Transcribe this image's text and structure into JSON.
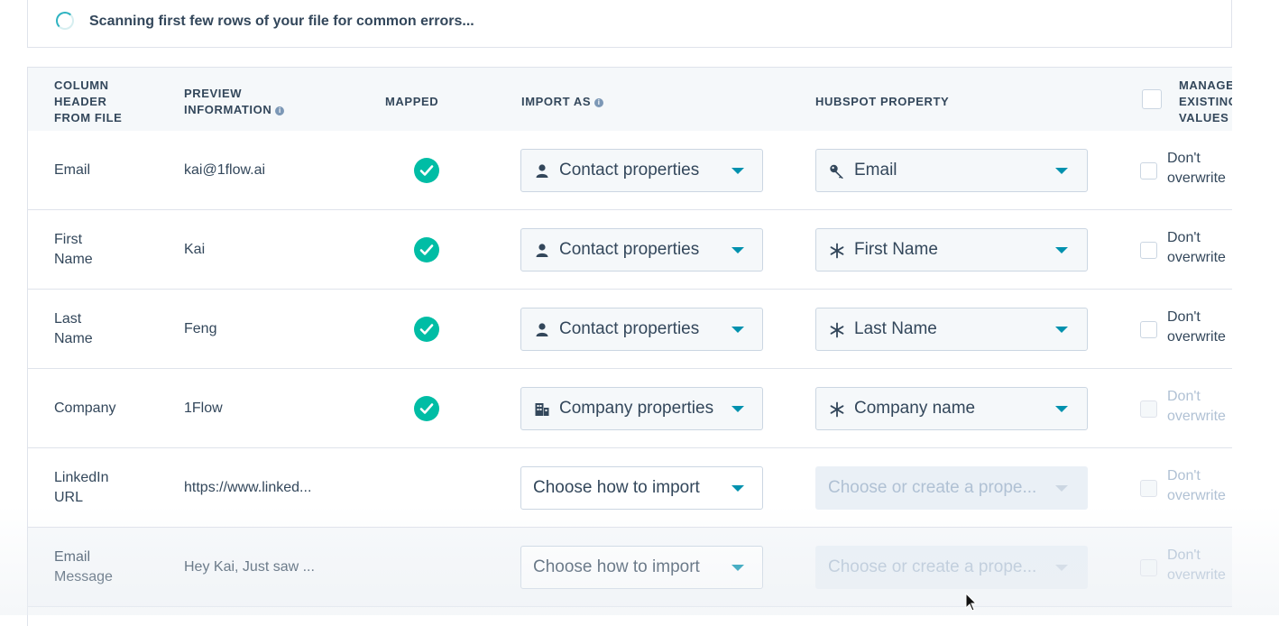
{
  "scan": {
    "message": "Scanning first few rows of your file for common errors..."
  },
  "table": {
    "headers": {
      "column_header": [
        "COLUMN",
        "HEADER",
        "FROM FILE"
      ],
      "preview": [
        "PREVIEW",
        "INFORMATION"
      ],
      "mapped": "MAPPED",
      "import_as": "IMPORT AS",
      "hubspot_property": "HUBSPOT PROPERTY",
      "manage": [
        "MANAGE",
        "EXISTING",
        "VALUES"
      ]
    },
    "rows": [
      {
        "column": [
          "Email"
        ],
        "preview": "kai@1flow.ai",
        "mapped": true,
        "import_as": {
          "label": "Contact properties",
          "icon": "person-icon"
        },
        "property": {
          "label": "Email",
          "icon": "key-icon",
          "disabled": false
        },
        "manage": [
          "Don't",
          "overwrite"
        ],
        "manage_enabled": true
      },
      {
        "column": [
          "First",
          "Name"
        ],
        "preview": "Kai",
        "mapped": true,
        "import_as": {
          "label": "Contact properties",
          "icon": "person-icon"
        },
        "property": {
          "label": "First Name",
          "icon": "asterisk-icon",
          "disabled": false
        },
        "manage": [
          "Don't",
          "overwrite"
        ],
        "manage_enabled": true
      },
      {
        "column": [
          "Last",
          "Name"
        ],
        "preview": "Feng",
        "mapped": true,
        "import_as": {
          "label": "Contact properties",
          "icon": "person-icon"
        },
        "property": {
          "label": "Last Name",
          "icon": "asterisk-icon",
          "disabled": false
        },
        "manage": [
          "Don't",
          "overwrite"
        ],
        "manage_enabled": true
      },
      {
        "column": [
          "Company"
        ],
        "preview": "1Flow",
        "mapped": true,
        "import_as": {
          "label": "Company properties",
          "icon": "building-icon"
        },
        "property": {
          "label": "Company name",
          "icon": "asterisk-icon",
          "disabled": false
        },
        "manage": [
          "Don't",
          "overwrite"
        ],
        "manage_enabled": false
      },
      {
        "column": [
          "LinkedIn",
          "URL"
        ],
        "preview": "https://www.linked...",
        "mapped": false,
        "import_as": {
          "label": "Choose how to import",
          "icon": ""
        },
        "property": {
          "label": "Choose or create a prope...",
          "icon": "",
          "disabled": true
        },
        "manage": [
          "Don't",
          "overwrite"
        ],
        "manage_enabled": false
      },
      {
        "column": [
          "Email",
          "Message"
        ],
        "preview": "Hey Kai, Just saw ...",
        "mapped": false,
        "import_as": {
          "label": "Choose how to import",
          "icon": ""
        },
        "property": {
          "label": "Choose or create a prope...",
          "icon": "",
          "disabled": true
        },
        "manage": [
          "Don't",
          "overwrite"
        ],
        "manage_enabled": false
      }
    ]
  },
  "colors": {
    "mapped_check": "#00bda5",
    "caret": "#0091ae",
    "header_bg": "#f5f8fa",
    "text": "#33475b"
  }
}
